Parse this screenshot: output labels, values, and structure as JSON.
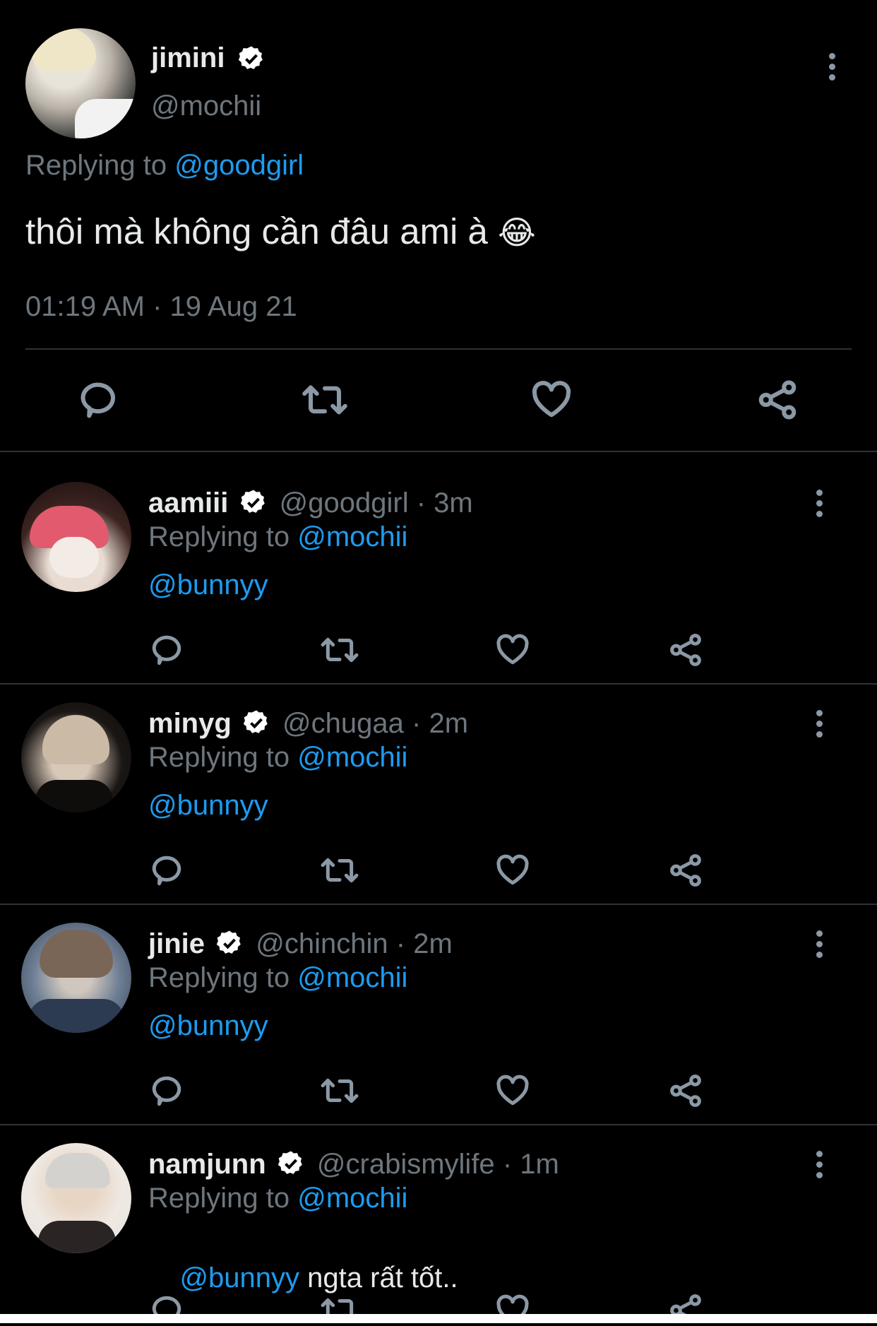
{
  "main_tweet": {
    "display_name": "jimini",
    "handle": "@mochii",
    "replying_label": "Replying to",
    "replying_to": "@goodgirl",
    "text": "thôi mà không cần đâu ami à",
    "emoji": "😂",
    "timestamp": "01:19 AM · 19 Aug 21"
  },
  "replies": [
    {
      "display_name": "aamiii",
      "handle": "@goodgirl",
      "time": "3m",
      "replying_label": "Replying to",
      "replying_to": "@mochii",
      "mention": "@bunnyy",
      "text": ""
    },
    {
      "display_name": "minyg",
      "handle": "@chugaa",
      "time": "2m",
      "replying_label": "Replying to",
      "replying_to": "@mochii",
      "mention": "@bunnyy",
      "text": ""
    },
    {
      "display_name": "jinie",
      "handle": "@chinchin",
      "time": "2m",
      "replying_label": "Replying to",
      "replying_to": "@mochii",
      "mention": "@bunnyy",
      "text": ""
    },
    {
      "display_name": "namjunn",
      "handle": "@crabismylife",
      "time": "1m",
      "replying_label": "Replying to",
      "replying_to": "@mochii",
      "mention": "@bunnyy",
      "text": " ngta rất tốt.."
    }
  ],
  "separator": "·",
  "icons": [
    "reply-icon",
    "retweet-icon",
    "like-icon",
    "share-icon",
    "verified-icon",
    "more-icon"
  ],
  "colors": {
    "background": "#000000",
    "link": "#1d9bf0",
    "muted": "#6e767d",
    "divider": "#2f3336",
    "icon": "#8b98a5"
  }
}
